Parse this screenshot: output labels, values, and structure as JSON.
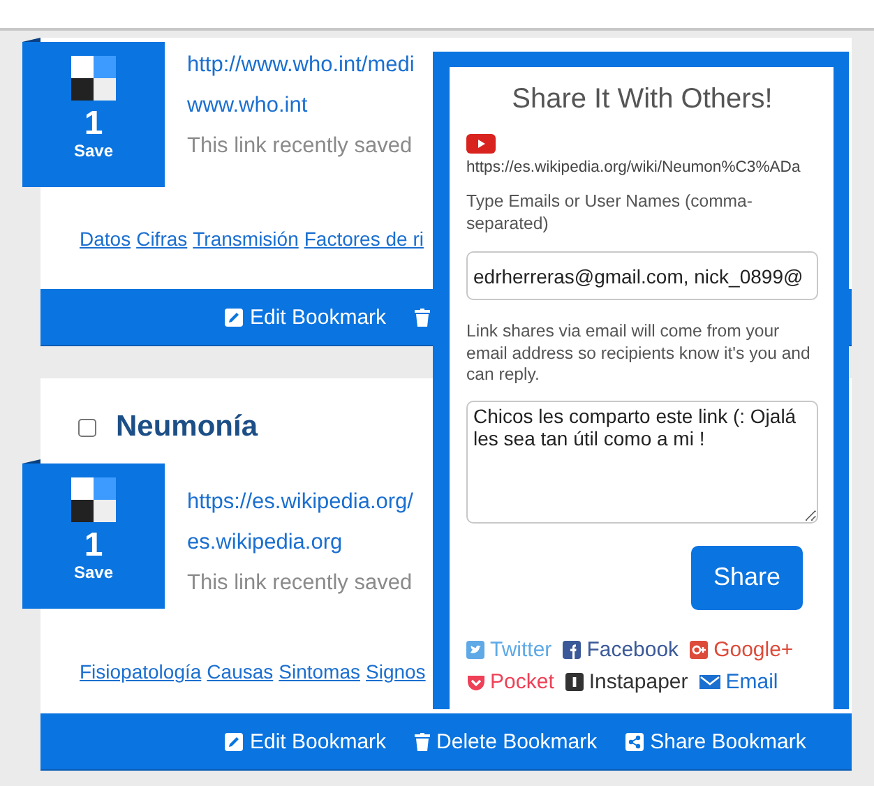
{
  "bookmarks": [
    {
      "save_count": "1",
      "save_label": "Save",
      "url": "http://www.who.int/medi",
      "domain": "www.who.int",
      "note": "This link recently saved",
      "tags": [
        "Datos",
        "Cifras",
        "Transmisión",
        "Factores de ri"
      ],
      "actions": [
        {
          "kind": "edit",
          "label": "Edit Bookmark"
        },
        {
          "kind": "delete"
        }
      ]
    },
    {
      "checked": false,
      "title": "Neumonía",
      "save_count": "1",
      "save_label": "Save",
      "url": "https://es.wikipedia.org/",
      "domain": "es.wikipedia.org",
      "note": "This link recently saved",
      "tags": [
        "Fisiopatología",
        "Causas",
        "Sintomas",
        "Signos"
      ],
      "actions": [
        {
          "kind": "edit",
          "label": "Edit Bookmark"
        },
        {
          "kind": "delete",
          "label": "Delete Bookmark"
        },
        {
          "kind": "share",
          "label": "Share Bookmark"
        }
      ]
    }
  ],
  "share_popup": {
    "title": "Share It With Others!",
    "url": "https://es.wikipedia.org/wiki/Neumon%C3%ADa",
    "recipients_label": "Type Emails or User Names (comma-separated)",
    "recipients_value": "edrherreras@gmail.com, nick_0899@",
    "note": "Link shares via email will come from your email address so recipients know it's you and can reply.",
    "message": "Chicos les comparto este link (: Ojalá les sea tan útil como a mi !",
    "button": "Share",
    "links": [
      {
        "kind": "twitter",
        "label": "Twitter",
        "color": "#5ea9e6"
      },
      {
        "kind": "facebook",
        "label": "Facebook",
        "color": "#3b5998"
      },
      {
        "kind": "googleplus",
        "label": "Google+",
        "color": "#dd4b39"
      },
      {
        "kind": "pocket",
        "label": "Pocket",
        "color": "#ee4056"
      },
      {
        "kind": "instapaper",
        "label": "Instapaper",
        "color": "#333333"
      },
      {
        "kind": "email",
        "label": "Email",
        "color": "#1a6fd0"
      }
    ]
  }
}
